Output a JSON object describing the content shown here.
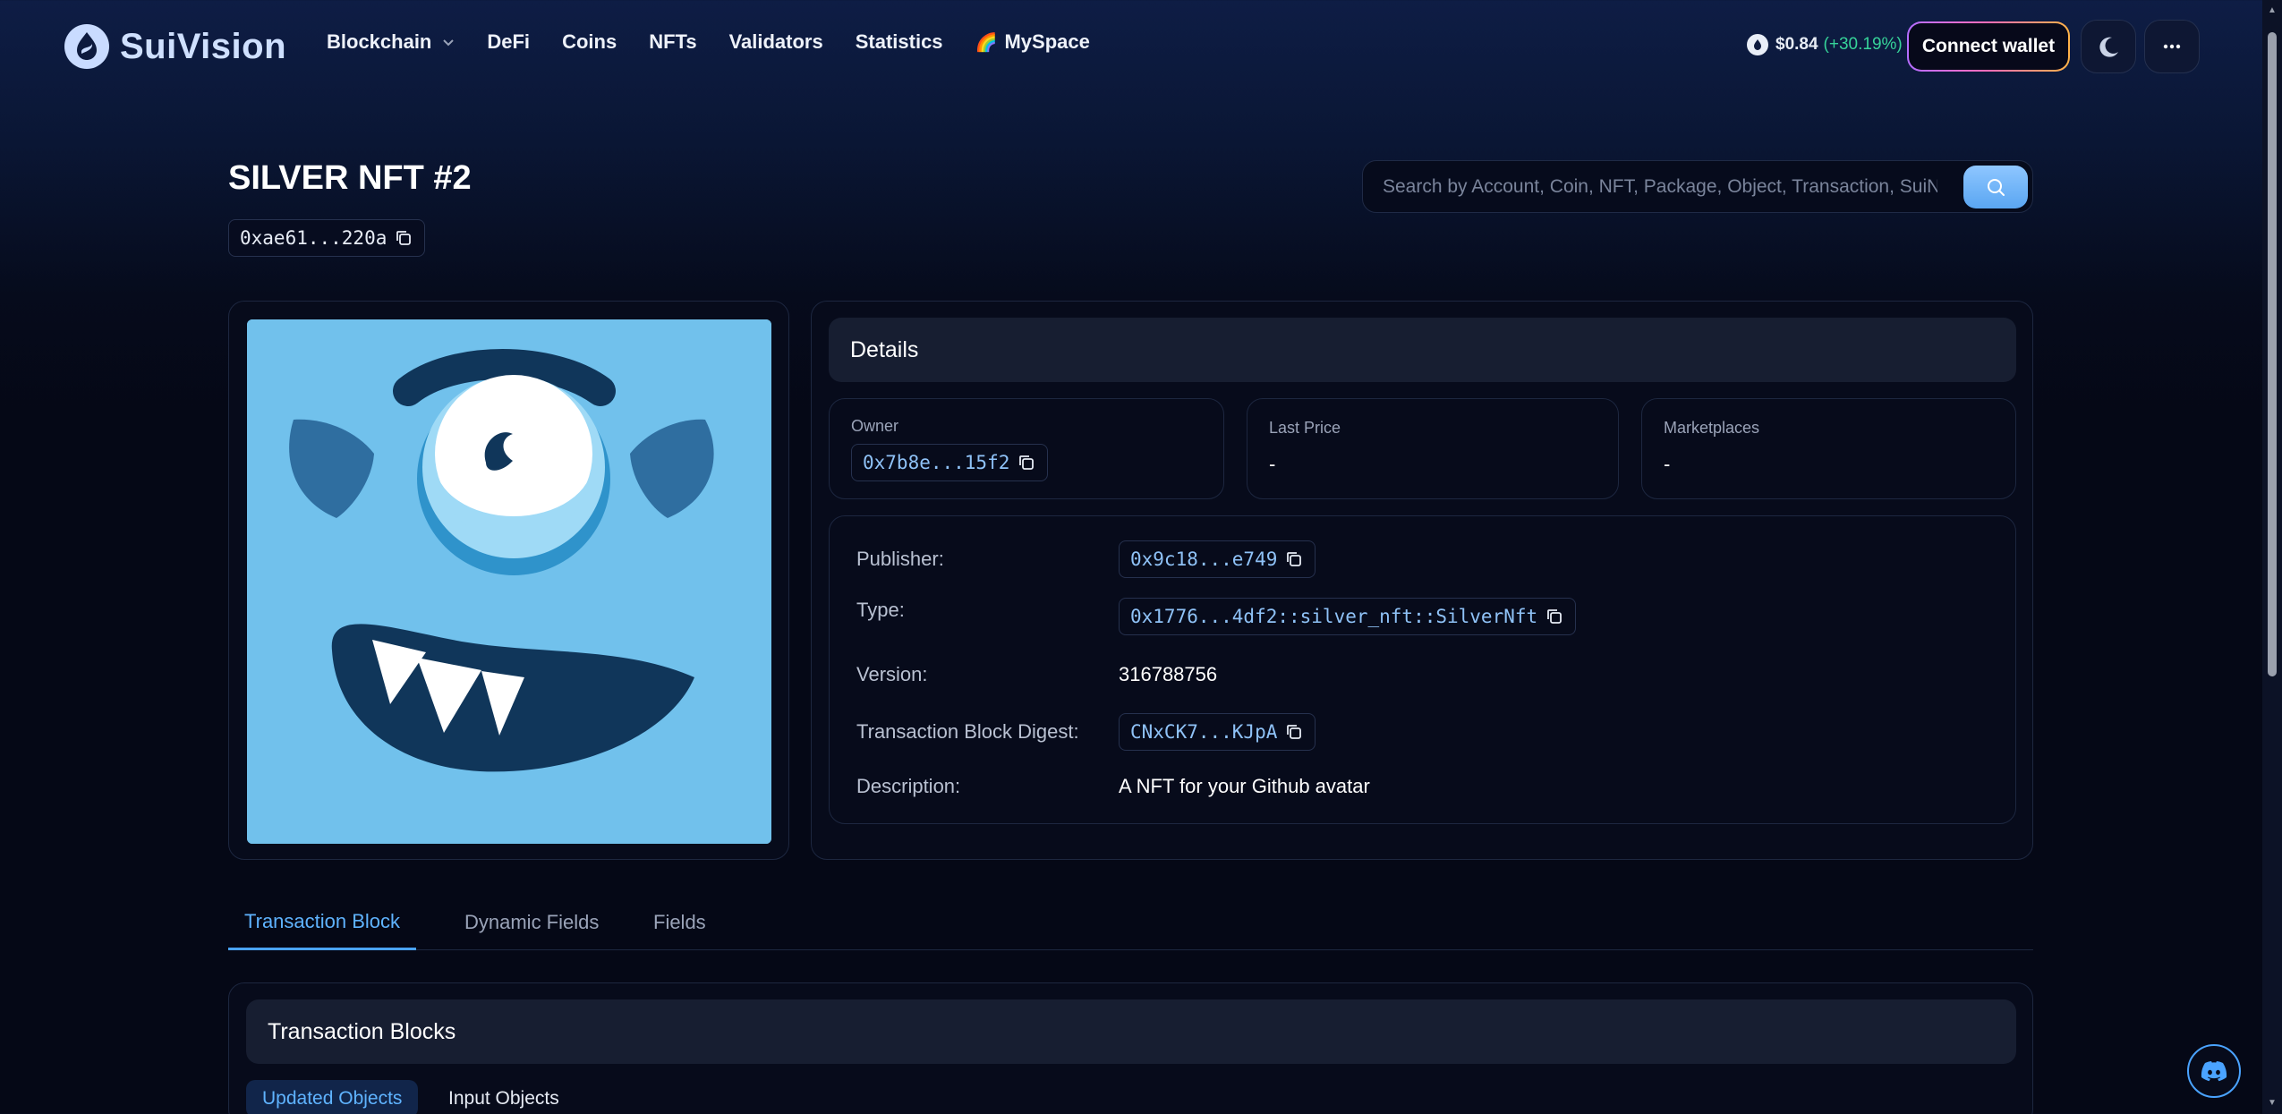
{
  "brand": {
    "name": "SuiVision"
  },
  "nav": {
    "items": [
      {
        "label": "Blockchain",
        "has_dropdown": true
      },
      {
        "label": "DeFi"
      },
      {
        "label": "Coins"
      },
      {
        "label": "NFTs"
      },
      {
        "label": "Validators"
      },
      {
        "label": "Statistics"
      },
      {
        "label": "MySpace",
        "icon": "rainbow-icon"
      }
    ]
  },
  "price": {
    "value": "$0.84",
    "change": "(+30.19%)",
    "change_color": "#36d399"
  },
  "header": {
    "connect_label": "Connect wallet"
  },
  "search": {
    "placeholder": "Search by Account, Coin, NFT, Package, Object, Transaction, SuiNS"
  },
  "page": {
    "title": "SILVER NFT #2",
    "object_id": "0xae61...220a"
  },
  "details": {
    "heading": "Details",
    "owner": {
      "label": "Owner",
      "value": "0x7b8e...15f2"
    },
    "last_price": {
      "label": "Last Price",
      "value": "-"
    },
    "marketplaces": {
      "label": "Marketplaces",
      "value": "-"
    },
    "rows": {
      "publisher": {
        "label": "Publisher:",
        "value": "0x9c18...e749"
      },
      "type": {
        "label": "Type:",
        "value": "0x1776...4df2::silver_nft::SilverNft"
      },
      "version": {
        "label": "Version:",
        "value": "316788756"
      },
      "digest": {
        "label": "Transaction Block Digest:",
        "value": "CNxCK7...KJpA"
      },
      "description": {
        "label": "Description:",
        "value": "A NFT for your Github avatar"
      }
    }
  },
  "tabs": [
    {
      "label": "Transaction Block",
      "active": true
    },
    {
      "label": "Dynamic Fields",
      "active": false
    },
    {
      "label": "Fields",
      "active": false
    }
  ],
  "tx_blocks": {
    "heading": "Transaction Blocks",
    "sub_tabs": [
      {
        "label": "Updated Objects",
        "active": true
      },
      {
        "label": "Input Objects",
        "active": false
      }
    ]
  },
  "colors": {
    "accent": "#4aa3ff",
    "link": "#8fc2f7",
    "nft_background": "#71c1ec"
  }
}
